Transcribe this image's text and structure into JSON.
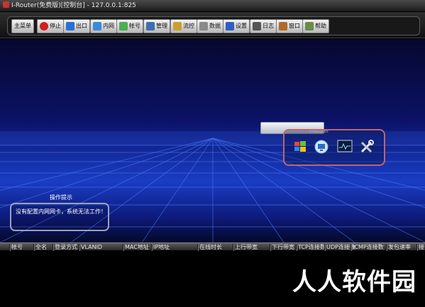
{
  "window": {
    "title": "I-Router(免费版)[控制台] - 127.0.0.1:825"
  },
  "toolbar": {
    "buttons": [
      {
        "label": "主菜单",
        "icon": "menu-icon",
        "color": "#cccccc"
      },
      {
        "label": "停止",
        "icon": "stop-icon",
        "color": "#d02020"
      },
      {
        "label": "出口",
        "icon": "exit-icon",
        "color": "#2a6fd6"
      },
      {
        "label": "内网",
        "icon": "lan-icon",
        "color": "#3a8ad8"
      },
      {
        "label": "帐号",
        "icon": "accounts-icon",
        "color": "#4caf50"
      },
      {
        "label": "管理",
        "icon": "admin-icon",
        "color": "#3c6fb0"
      },
      {
        "label": "流控",
        "icon": "flow-control-icon",
        "color": "#c8a030"
      },
      {
        "label": "数据",
        "icon": "data-icon",
        "color": "#8a8a8a"
      },
      {
        "label": "设置",
        "icon": "settings-icon",
        "color": "#2f5fc0"
      },
      {
        "label": "日志",
        "icon": "log-icon",
        "color": "#555555"
      },
      {
        "label": "窗口",
        "icon": "window-icon",
        "color": "#b06a2a"
      },
      {
        "label": "帮助",
        "icon": "help-icon",
        "color": "#6a8a4a"
      }
    ]
  },
  "stage": {
    "device_label": "I-Router",
    "panel_icons": [
      "windows-icon",
      "monitor-icon",
      "terminal-icon",
      "tools-icon"
    ]
  },
  "tip": {
    "title": "操作提示",
    "message": "没有配置内网网卡，系统无法工作！"
  },
  "table": {
    "columns": [
      "帐号",
      "全名",
      "登录方式",
      "VLANID",
      "MAC地址",
      "IP地址",
      "在线时长",
      "上行带宽",
      "下行带宽",
      "TCP连接数",
      "UDP连接数",
      "ICMP连接数",
      "发包速率",
      "接"
    ]
  },
  "watermark": "人人软件园"
}
